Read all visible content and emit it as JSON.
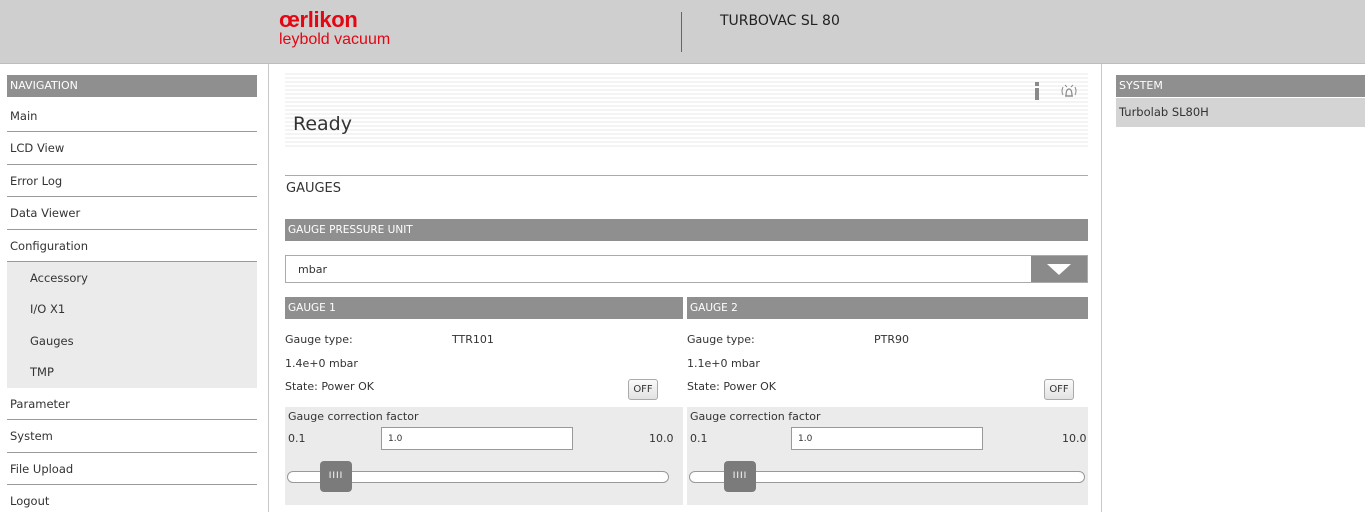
{
  "header": {
    "brand": "œrlikon",
    "brand_sub": "leybold vacuum",
    "product_title": "TURBOVAC SL 80"
  },
  "navigation": {
    "header": "NAVIGATION",
    "items": [
      {
        "label": "Main"
      },
      {
        "label": "LCD View"
      },
      {
        "label": "Error Log"
      },
      {
        "label": "Data Viewer"
      },
      {
        "label": "Configuration"
      }
    ],
    "sub_items": [
      {
        "label": "Accessory"
      },
      {
        "label": "I/O X1"
      },
      {
        "label": "Gauges"
      },
      {
        "label": "TMP"
      }
    ],
    "items_after": [
      {
        "label": "Parameter"
      },
      {
        "label": "System"
      },
      {
        "label": "File Upload"
      },
      {
        "label": "Logout"
      }
    ]
  },
  "status": {
    "text": "Ready",
    "icons": [
      "info-icon",
      "alarm-icon"
    ]
  },
  "main": {
    "section_title": "GAUGES",
    "unit_header": "GAUGE PRESSURE UNIT",
    "unit_value": "mbar"
  },
  "gauges": [
    {
      "header": "GAUGE 1",
      "type_label": "Gauge type:",
      "type_value": "TTR101",
      "pressure": "1.4e+0 mbar",
      "state": "State: Power OK",
      "off_label": "OFF",
      "correction_title": "Gauge correction factor",
      "min": "0.1",
      "max": "10.0",
      "value": "1.0",
      "thumb_label": "IIII"
    },
    {
      "header": "GAUGE 2",
      "type_label": "Gauge type:",
      "type_value": "PTR90",
      "pressure": "1.1e+0 mbar",
      "state": "State: Power OK",
      "off_label": "OFF",
      "correction_title": "Gauge correction factor",
      "min": "0.1",
      "max": "10.0",
      "value": "1.0",
      "thumb_label": "IIII"
    }
  ],
  "system": {
    "header": "SYSTEM",
    "item": "Turbolab SL80H"
  },
  "colors": {
    "brand_red": "#e30613",
    "panel_header": "#8f8f8f",
    "header_bg": "#cfcfcf"
  }
}
